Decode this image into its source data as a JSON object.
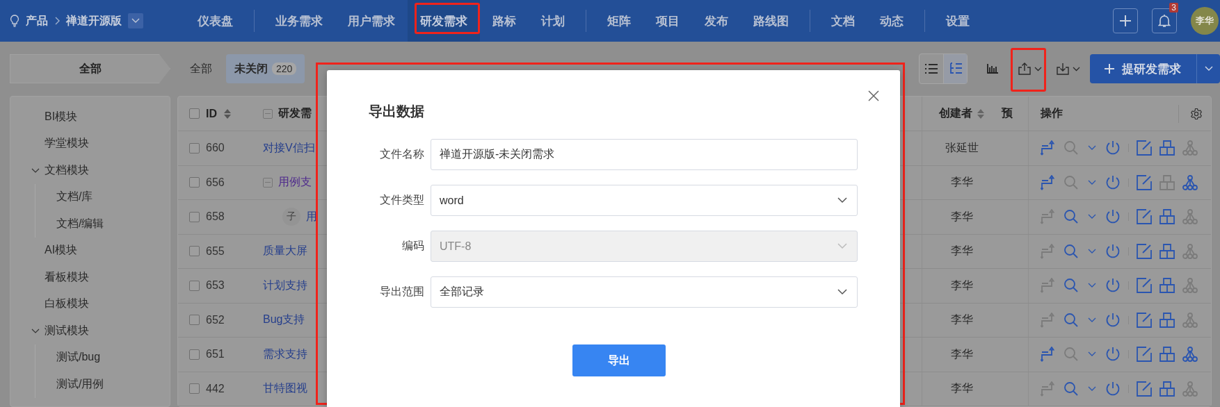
{
  "top_bar": {
    "product_label": "产品",
    "product_name": "禅道开源版",
    "nav_groups": [
      [
        {
          "label": "仪表盘",
          "selected": false,
          "highlighted": false
        }
      ],
      [
        {
          "label": "业务需求",
          "selected": false,
          "highlighted": false
        },
        {
          "label": "用户需求",
          "selected": false,
          "highlighted": false
        },
        {
          "label": "研发需求",
          "selected": true,
          "highlighted": true
        },
        {
          "label": "路标",
          "selected": false,
          "highlighted": false
        },
        {
          "label": "计划",
          "selected": false,
          "highlighted": false
        }
      ],
      [
        {
          "label": "矩阵",
          "selected": false,
          "highlighted": false
        },
        {
          "label": "项目",
          "selected": false,
          "highlighted": false
        },
        {
          "label": "发布",
          "selected": false,
          "highlighted": false
        },
        {
          "label": "路线图",
          "selected": false,
          "highlighted": false
        }
      ],
      [
        {
          "label": "文档",
          "selected": false,
          "highlighted": false
        },
        {
          "label": "动态",
          "selected": false,
          "highlighted": false
        }
      ],
      [
        {
          "label": "设置",
          "selected": false,
          "highlighted": false
        }
      ]
    ],
    "notification_count": "3",
    "user_avatar": "李华"
  },
  "toolbar": {
    "scope": "全部",
    "tabs": [
      {
        "label": "全部",
        "selected": false
      },
      {
        "label": "未关闭",
        "count": "220",
        "selected": true
      }
    ],
    "view_modes": [
      {
        "kind": "list",
        "selected": false
      },
      {
        "kind": "tree",
        "selected": true
      }
    ],
    "export_highlighted": true,
    "create_button": "提研发需求"
  },
  "sidebar": {
    "items": [
      {
        "label": "BI模块"
      },
      {
        "label": "学堂模块"
      },
      {
        "label": "文档模块",
        "expanded": true,
        "children": [
          {
            "label": "文档/库"
          },
          {
            "label": "文档/编辑"
          }
        ]
      },
      {
        "label": "AI模块"
      },
      {
        "label": "看板模块"
      },
      {
        "label": "白板模块"
      },
      {
        "label": "测试模块",
        "expanded": true,
        "children": [
          {
            "label": "测试/bug"
          },
          {
            "label": "测试/用例"
          }
        ]
      }
    ]
  },
  "table": {
    "header_checked": false,
    "columns": [
      {
        "label": "ID",
        "sortable": true
      },
      {
        "label": "研发需",
        "sortable": false
      },
      {
        "label": "创建者",
        "sortable": true
      },
      {
        "label": "预",
        "sortable": false
      },
      {
        "label": "操作",
        "sortable": false
      }
    ],
    "rows": [
      {
        "id": "660",
        "checked": false,
        "kind": "story",
        "title": "对接V信扫",
        "creator": "张延世",
        "actions": [
          true,
          false,
          true,
          true,
          true,
          true,
          false
        ]
      },
      {
        "id": "656",
        "checked": false,
        "kind": "parent",
        "title": "用例支",
        "creator": "李华",
        "actions": [
          true,
          false,
          true,
          true,
          true,
          false,
          true
        ]
      },
      {
        "id": "658",
        "checked": false,
        "kind": "child",
        "badge": "子",
        "title": "用",
        "creator": "李华",
        "actions": [
          false,
          true,
          true,
          true,
          true,
          true,
          false
        ]
      },
      {
        "id": "655",
        "checked": false,
        "kind": "story",
        "title": "质量大屏",
        "creator": "李华",
        "actions": [
          false,
          true,
          true,
          true,
          true,
          true,
          false
        ]
      },
      {
        "id": "653",
        "checked": false,
        "kind": "story",
        "title": "计划支持",
        "creator": "李华",
        "actions": [
          false,
          true,
          true,
          true,
          true,
          true,
          false
        ]
      },
      {
        "id": "652",
        "checked": false,
        "kind": "story",
        "title": "Bug支持",
        "creator": "李华",
        "actions": [
          false,
          true,
          true,
          true,
          true,
          true,
          false
        ]
      },
      {
        "id": "651",
        "checked": false,
        "kind": "story",
        "title": "需求支持",
        "creator": "李华",
        "actions": [
          true,
          false,
          true,
          true,
          true,
          true,
          true
        ]
      },
      {
        "id": "442",
        "checked": false,
        "kind": "story",
        "title": "甘特图视",
        "creator": "李华",
        "actions": [
          false,
          true,
          true,
          true,
          true,
          true,
          false
        ]
      }
    ]
  },
  "dialog": {
    "title": "导出数据",
    "highlighted": true,
    "fields": [
      {
        "label": "文件名称",
        "kind": "text",
        "value": "禅道开源版-未关闭需求",
        "disabled": false
      },
      {
        "label": "文件类型",
        "kind": "select",
        "value": "word",
        "disabled": false
      },
      {
        "label": "编码",
        "kind": "select",
        "value": "UTF-8",
        "disabled": true
      },
      {
        "label": "导出范围",
        "kind": "select",
        "value": "全部记录",
        "disabled": false
      }
    ],
    "submit": "导出"
  }
}
